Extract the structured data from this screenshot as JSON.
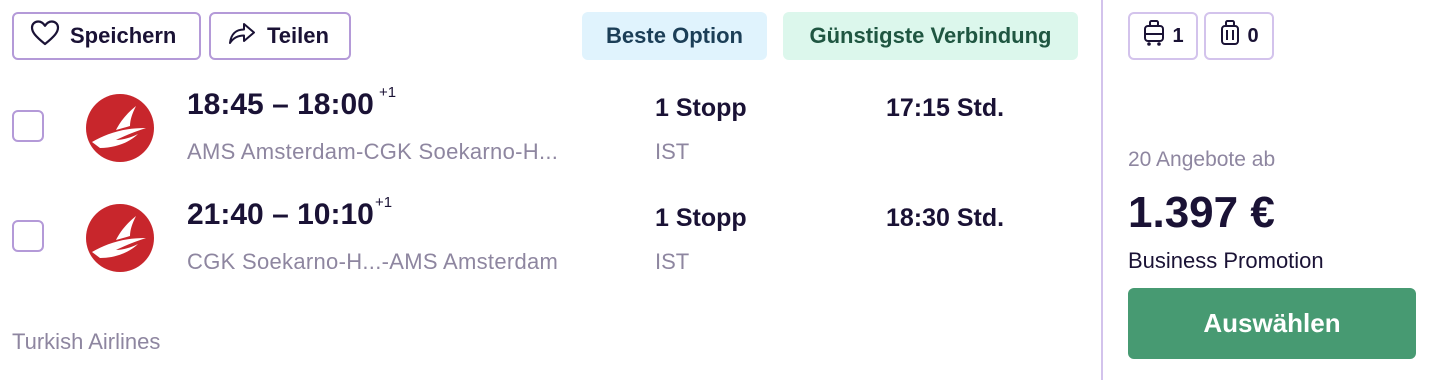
{
  "actions": {
    "save_label": "Speichern",
    "share_label": "Teilen"
  },
  "tags": {
    "best": "Beste Option",
    "cheapest": "Günstigste Verbindung"
  },
  "legs": [
    {
      "departure": "18:45",
      "separator": "–",
      "arrival": "18:00",
      "day_offset": "+1",
      "route": "AMS Amsterdam-CGK Soekarno-H...",
      "stops": "1 Stopp",
      "via": "IST",
      "duration": "17:15 Std."
    },
    {
      "departure": "21:40",
      "separator": "–",
      "arrival": "10:10",
      "day_offset": "+1",
      "route": "CGK Soekarno-H...-AMS Amsterdam",
      "stops": "1 Stopp",
      "via": "IST",
      "duration": "18:30 Std."
    }
  ],
  "airline": "Turkish Airlines",
  "baggage": {
    "cabin_count": "1",
    "checked_count": "0"
  },
  "offer": {
    "offers_text": "20 Angebote ab",
    "price": "1.397 €",
    "fare_name": "Business Promotion",
    "select_label": "Auswählen"
  },
  "colors": {
    "accent_border": "#b49ad8",
    "select_button": "#479a72",
    "best_tag_bg": "#e0f3fd",
    "cheapest_tag_bg": "#dcf7ec",
    "airline_logo": "#c8262c"
  },
  "icons": {
    "save": "heart-icon",
    "share": "share-arrow-icon",
    "cabin_bag": "cabin-bag-icon",
    "checked_bag": "checked-bag-icon",
    "airline_logo": "turkish-airlines-logo"
  }
}
